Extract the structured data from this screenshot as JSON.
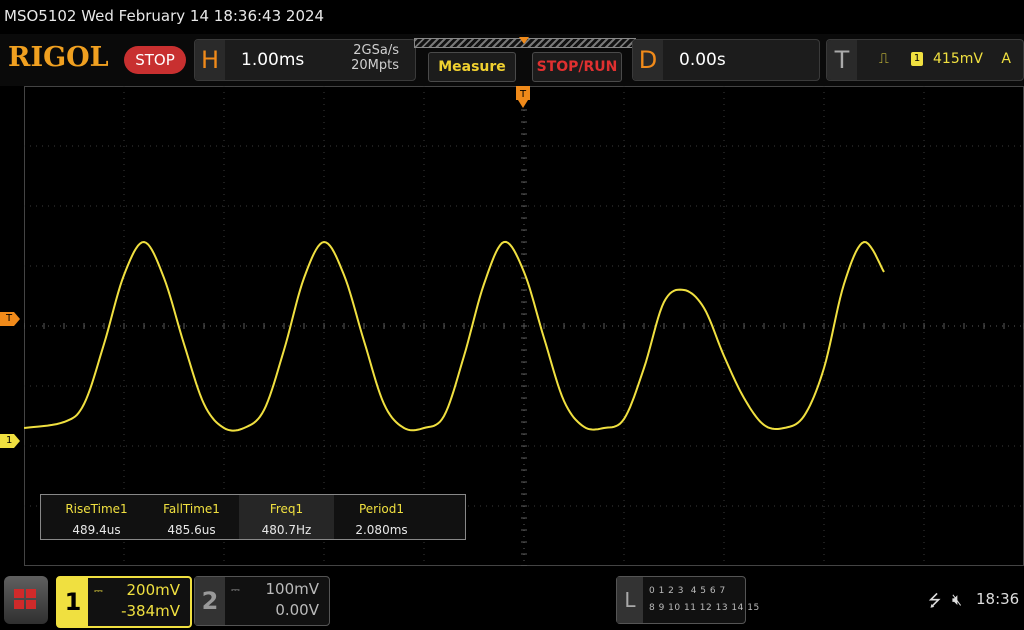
{
  "title_bar": {
    "text": "MSO5102  Wed February 14 18:36:43 2024"
  },
  "toolbar": {
    "logo": "RIGOL",
    "run_status": "STOP",
    "horizontal": {
      "letter": "H",
      "timebase": "1.00ms",
      "sample_rate": "2GSa/s",
      "memory_depth": "20Mpts"
    },
    "measure_label": "Measure",
    "stop_run_label": "STOP/RUN",
    "delay": {
      "letter": "D",
      "value": "0.00s"
    },
    "trigger": {
      "letter": "T",
      "source": "1",
      "level": "415mV",
      "mode": "A"
    }
  },
  "markers": {
    "trigger_level": "T",
    "channel1": "1"
  },
  "colors": {
    "channel1": "#f0e040",
    "accent": "#f08a1a",
    "stop": "#c83030"
  },
  "chart_data": {
    "type": "line",
    "series": [
      {
        "name": "",
        "x_ms": [
          -5.0,
          -4.6,
          -4.4,
          -4.2,
          -4.0,
          -3.8,
          -3.6,
          -3.4,
          -3.2,
          -3.0,
          -2.8,
          -2.6,
          -2.4,
          -2.2,
          -2.0,
          -1.8,
          -1.6,
          -1.4,
          -1.2,
          -1.0,
          -0.8,
          -0.6,
          -0.4,
          -0.2,
          0.0,
          0.2,
          0.4,
          0.6,
          0.8,
          1.0,
          1.2,
          1.4,
          1.6,
          1.8,
          2.0,
          2.2,
          2.4,
          2.6,
          2.8,
          3.0,
          3.2,
          3.4,
          3.6,
          3.8,
          4.0,
          4.2,
          4.4,
          4.6,
          5.0
        ],
        "y_div": [
          -1.7,
          -1.6,
          -1.3,
          -0.3,
          0.85,
          1.4,
          0.8,
          -0.3,
          -1.3,
          -1.7,
          -1.7,
          -1.4,
          -0.4,
          0.8,
          1.4,
          0.85,
          -0.25,
          -1.3,
          -1.7,
          -1.7,
          -1.5,
          -0.5,
          0.7,
          1.4,
          0.9,
          -0.2,
          -1.25,
          -1.68,
          -1.7,
          -1.55,
          -0.7,
          0.4,
          0.6,
          0.3,
          -0.5,
          -1.2,
          -1.65,
          -1.7,
          -1.5,
          -0.7,
          0.7,
          1.4,
          0.9
        ]
      }
    ],
    "xlim": [
      -5,
      5
    ],
    "ylim": [
      -4,
      4
    ],
    "grid": true
  },
  "measurements": [
    {
      "name": "RiseTime1",
      "value": "489.4us",
      "highlight": false
    },
    {
      "name": "FallTime1",
      "value": "485.6us",
      "highlight": false
    },
    {
      "name": "Freq1",
      "value": "480.7Hz",
      "highlight": true
    },
    {
      "name": "Period1",
      "value": "2.080ms",
      "highlight": false
    }
  ],
  "bottom": {
    "ch1": {
      "num": "1",
      "scale": "200mV",
      "offset": "-384mV"
    },
    "ch2": {
      "num": "2",
      "scale": "100mV",
      "offset": "0.00V"
    },
    "la": {
      "letter": "L",
      "row1": "0 1 2 3  4 5 6 7",
      "row2": "8 9 10 11 12 13 14 15"
    },
    "usb_icon": "usb-icon",
    "speaker_icon": "speaker-muted-icon",
    "time": "18:36"
  }
}
